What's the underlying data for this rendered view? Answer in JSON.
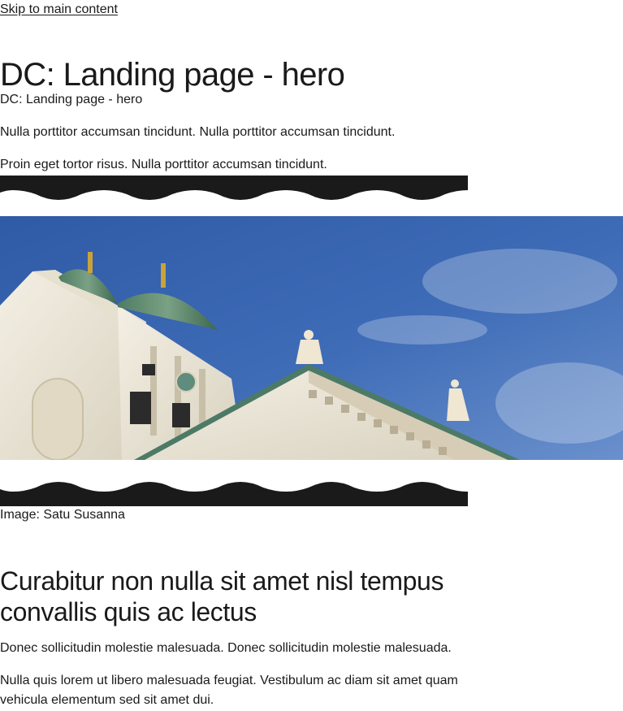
{
  "skip_link": "Skip to main content",
  "hero": {
    "title": "DC: Landing page - hero",
    "subtitle": "DC: Landing page - hero",
    "paragraphs": [
      "Nulla porttitor accumsan tincidunt. Nulla porttitor accumsan tincidunt.",
      "Proin eget tortor risus. Nulla porttitor accumsan tincidunt."
    ],
    "image_caption": "Image: Satu Susanna"
  },
  "section": {
    "heading": "Curabitur non nulla sit amet nisl tempus convallis quis ac lectus",
    "paragraphs": [
      "Donec sollicitudin molestie malesuada. Donec sollicitudin molestie malesuada.",
      "Nulla quis lorem ut libero malesuada feugiat. Vestibulum ac diam sit amet quam vehicula elementum sed sit amet dui."
    ]
  },
  "colors": {
    "text": "#1a1a1a",
    "koros": "#1a1a1a",
    "sky": "#3d67b0",
    "background": "#ffffff"
  }
}
